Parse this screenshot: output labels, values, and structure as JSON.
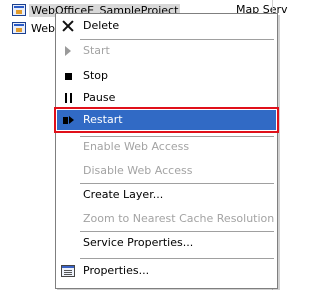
{
  "background": {
    "rows": [
      {
        "label": "WebOfficeE_SampleProject"
      },
      {
        "label": "WebO"
      }
    ],
    "type_column_text": "Map Serv"
  },
  "menu": {
    "items": [
      {
        "label": "Delete",
        "icon": "close-icon",
        "enabled": true
      },
      {
        "label": "Start",
        "icon": "play-icon",
        "enabled": false
      },
      {
        "label": "Stop",
        "icon": "stop-icon",
        "enabled": true
      },
      {
        "label": "Pause",
        "icon": "pause-icon",
        "enabled": true
      },
      {
        "label": "Restart",
        "icon": "restart-icon",
        "enabled": true,
        "highlighted": true
      },
      {
        "label": "Enable Web Access",
        "enabled": false
      },
      {
        "label": "Disable Web Access",
        "enabled": false
      },
      {
        "label": "Create Layer...",
        "enabled": true
      },
      {
        "label": "Zoom to Nearest Cache Resolution",
        "enabled": false
      },
      {
        "label": "Service Properties...",
        "enabled": true
      },
      {
        "label": "Properties...",
        "icon": "properties-icon",
        "enabled": true
      }
    ]
  },
  "colors": {
    "highlight_bg": "#316ac5",
    "highlight_outline": "#e0101a",
    "disabled_text": "#a3a3a3"
  }
}
